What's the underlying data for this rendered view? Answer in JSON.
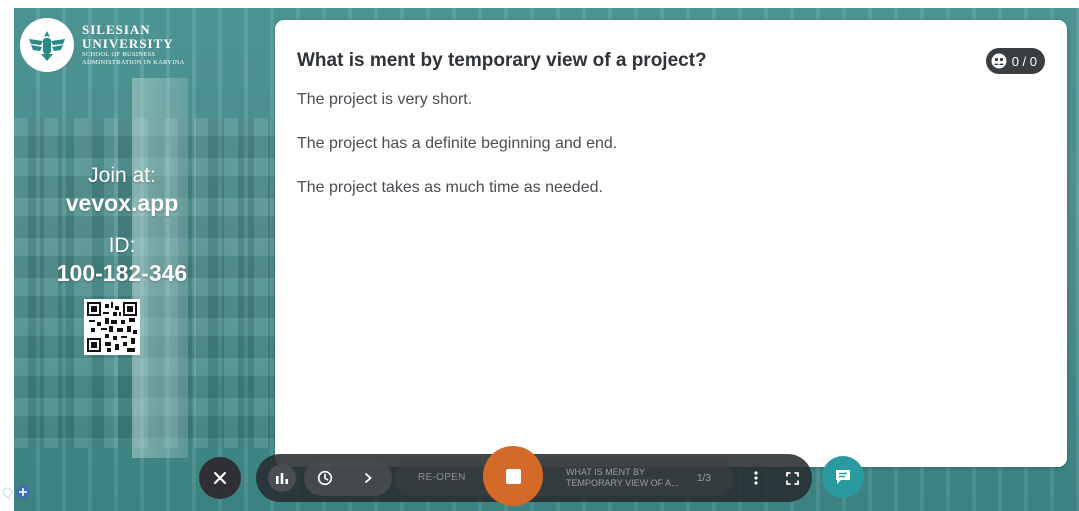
{
  "branding": {
    "line1": "SILESIAN",
    "line2": "UNIVERSITY",
    "line3": "SCHOOL OF BUSINESS",
    "line4": "ADMINISTRATION IN KARVINA"
  },
  "join": {
    "label": "Join at:",
    "url": "vevox.app",
    "id_label": "ID:",
    "id_value": "100-182-346"
  },
  "question": {
    "title": "What is ment by temporary view of a project?",
    "response_count": "0 / 0",
    "options": [
      "The project is very short.",
      "The project has a definite beginning and end.",
      "The project takes as much time as needed."
    ]
  },
  "toolbar": {
    "reopen_label": "RE-OPEN",
    "current_title": "WHAT IS MENT BY TEMPORARY VIEW OF A...",
    "position": "1/3"
  },
  "corner": {
    "letter": "Q"
  },
  "colors": {
    "stop": "#d46a2a",
    "chat": "#2a9aa0",
    "toolbar": "#2f3035"
  }
}
